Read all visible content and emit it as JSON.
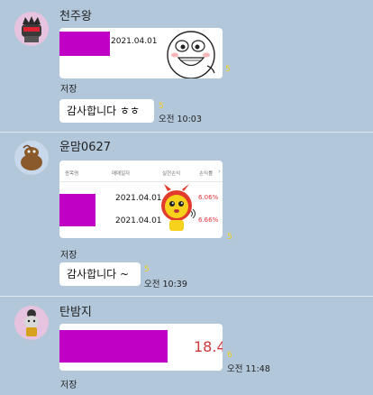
{
  "messages": [
    {
      "sender": "천주왕",
      "card": {
        "date": "2021.04.01"
      },
      "save_label": "저장",
      "reply": {
        "text": "감사합니다 ㅎㅎ",
        "unread": "5",
        "time": "오전 10:03"
      },
      "card_unread": "5"
    },
    {
      "sender": "윤맘0627",
      "card": {
        "headers": [
          "종목명",
          "매매일자",
          "실현손익",
          "손익률"
        ],
        "rows": [
          {
            "date": "2021.04.01",
            "rate": "6.06%"
          },
          {
            "date": "2021.04.01",
            "rate": "6.66%"
          }
        ]
      },
      "card_unread": "5",
      "save_label": "저장",
      "reply": {
        "text": "감사합니다 ~",
        "unread": "5",
        "time": "오전 10:39"
      }
    },
    {
      "sender": "탄밤지",
      "card": {
        "value": "18.4"
      },
      "card_unread": "6",
      "card_time": "오전 11:48",
      "save_label": "저장"
    }
  ],
  "colors": {
    "background": "#b2c7da",
    "redaction": "#c000c4",
    "unread": "#f5d31c",
    "profit": "#e0343c"
  }
}
